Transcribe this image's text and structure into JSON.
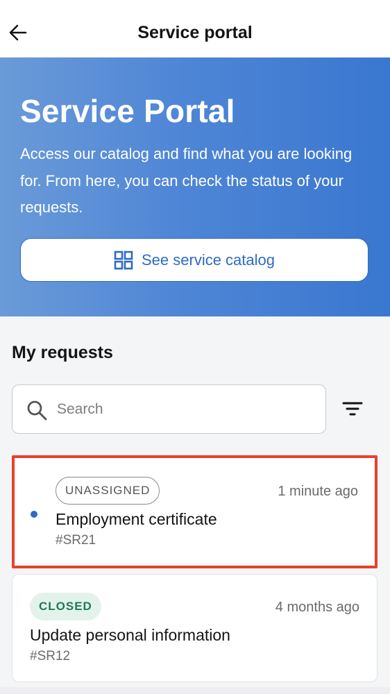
{
  "header": {
    "title": "Service portal",
    "back_icon": "arrow-left-icon"
  },
  "hero": {
    "title": "Service Portal",
    "description": "Access our catalog and find what you are looking for. From here, you can check the status of your requests.",
    "catalog_button_label": "See service catalog",
    "catalog_button_icon": "grid-icon",
    "gradient_start": "#6a9ad8",
    "gradient_end": "#3a77d0"
  },
  "requests": {
    "section_title": "My requests",
    "search": {
      "placeholder": "Search",
      "value": ""
    },
    "filter_icon": "filter-icon",
    "items": [
      {
        "status": "UNASSIGNED",
        "time": "1 minute ago",
        "title": "Employment certificate",
        "id": "#SR21",
        "unread": true
      },
      {
        "status": "CLOSED",
        "time": "4 months ago",
        "title": "Update personal information",
        "id": "#SR12",
        "unread": false
      }
    ]
  },
  "colors": {
    "accent": "#2d6bc4",
    "highlight": "#e8412a",
    "closed_badge_bg": "#e4f2ec",
    "closed_badge_text": "#1f7a55"
  }
}
